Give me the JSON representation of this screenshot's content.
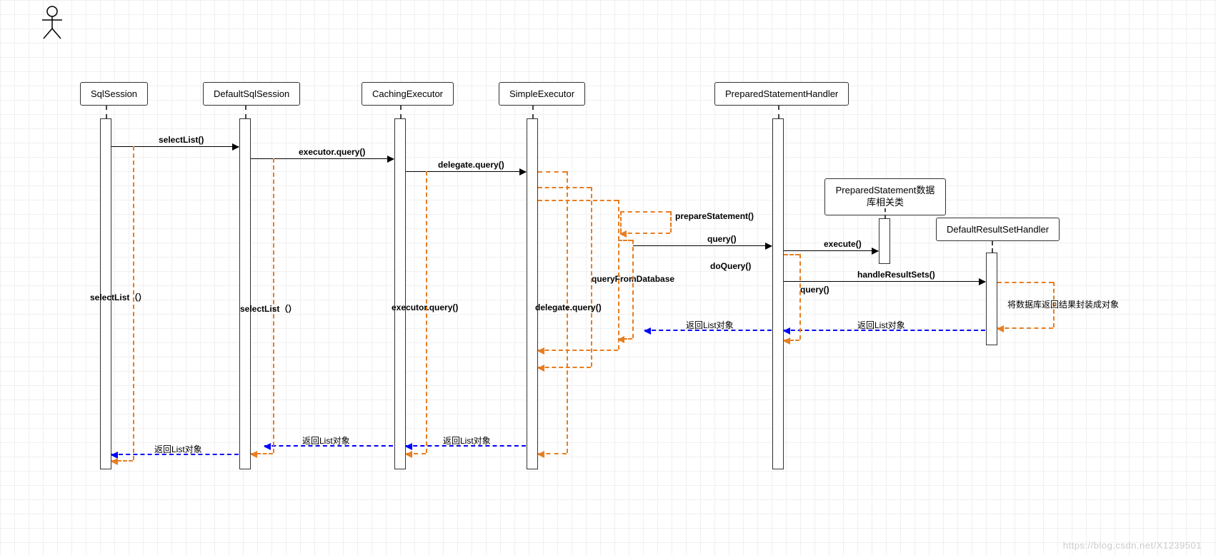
{
  "actor": "user",
  "lifelines": {
    "sqlSession": "SqlSession",
    "defaultSqlSession": "DefaultSqlSession",
    "cachingExecutor": "CachingExecutor",
    "simpleExecutor": "SimpleExecutor",
    "preparedStatementHandler": "PreparedStatementHandler",
    "preparedStatement": "PreparedStatement数据库相关类",
    "defaultResultSetHandler": "DefaultResultSetHandler"
  },
  "messages": {
    "selectList_call": "selectList()",
    "executorQuery_call": "executor.query()",
    "delegateQuery_call": "delegate.query()",
    "prepareStatement_call": "prepareStatement()",
    "query_call": "query()",
    "execute_call": "execute()",
    "doQuery_call": "doQuery()",
    "handleResultSets_call": "handleResultSets()",
    "queryFromDatabase": "queryFromDatabase",
    "selectList_ret": "selectList（）",
    "executorQuery_ret": "executor.query()",
    "delegateQuery_ret": "delegate.query()",
    "query_ret": "query()",
    "returnList": "返回List对象",
    "resultWrap": "将数据库返回结果封装成对象"
  },
  "watermark": "https://blog.csdn.net/X1239501"
}
